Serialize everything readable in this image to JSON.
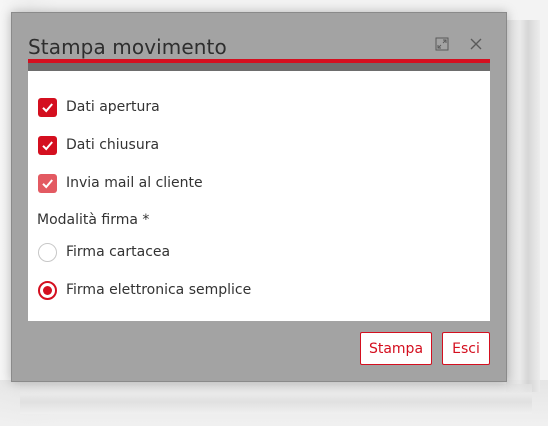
{
  "dialog": {
    "title": "Stampa movimento",
    "icons": {
      "restore": "restore-window-icon",
      "close": "close-icon"
    }
  },
  "options": {
    "dati_apertura": {
      "label": "Dati apertura",
      "checked": true
    },
    "dati_chiusura": {
      "label": "Dati chiusura",
      "checked": true
    },
    "invia_mail": {
      "label": "Invia mail al cliente",
      "checked": true
    }
  },
  "firma": {
    "section_label": "Modalità firma *",
    "choices": [
      {
        "label": "Firma cartacea",
        "selected": false
      },
      {
        "label": "Firma elettronica semplice",
        "selected": true
      }
    ]
  },
  "footer": {
    "print_label": "Stampa",
    "exit_label": "Esci"
  },
  "colors": {
    "accent": "#d40f1f",
    "dialog_bg": "#a3a3a3",
    "content_bg": "#ffffff"
  }
}
